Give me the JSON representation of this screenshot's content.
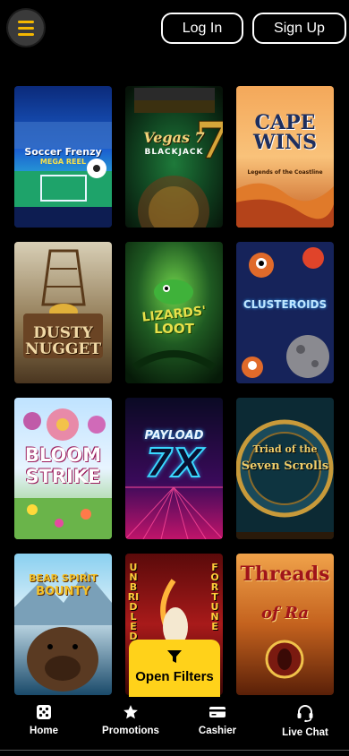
{
  "header": {
    "menu_icon": "hamburger-menu-icon",
    "login_label": "Log In",
    "signup_label": "Sign Up",
    "accent_color": "#f5b800"
  },
  "games": [
    {
      "title": "Soccer Frenzy",
      "subtitle": "MEGA REEL"
    },
    {
      "title": "Vegas 7",
      "subtitle": "BLACKJACK"
    },
    {
      "title": "CAPE WINS",
      "subtitle": "Legends of the Coastline"
    },
    {
      "title": "DUSTY",
      "subtitle": "NUGGET"
    },
    {
      "title": "LIZARDS'",
      "subtitle": "LOOT"
    },
    {
      "title": "CLUSTEROIDS",
      "subtitle": ""
    },
    {
      "title": "BLOOM",
      "subtitle": "STRIKE"
    },
    {
      "title": "PAYLOAD",
      "subtitle": "7X"
    },
    {
      "title": "Triad of the",
      "subtitle": "Seven Scrolls"
    },
    {
      "title": "BEAR SPIRIT",
      "subtitle": "BOUNTY"
    },
    {
      "title": "UNBRIDLED",
      "subtitle": "FORTUNE"
    },
    {
      "title": "Threads",
      "subtitle": "of Ra"
    }
  ],
  "filter": {
    "label": "Open Filters",
    "icon": "funnel-icon",
    "color": "#ffd21a"
  },
  "nav": {
    "home": {
      "label": "Home",
      "icon": "dice-icon"
    },
    "promotions": {
      "label": "Promotions",
      "icon": "star-icon"
    },
    "cashier": {
      "label": "Cashier",
      "icon": "credit-card-icon"
    },
    "livechat": {
      "label": "Live Chat",
      "icon": "headset-icon"
    }
  }
}
